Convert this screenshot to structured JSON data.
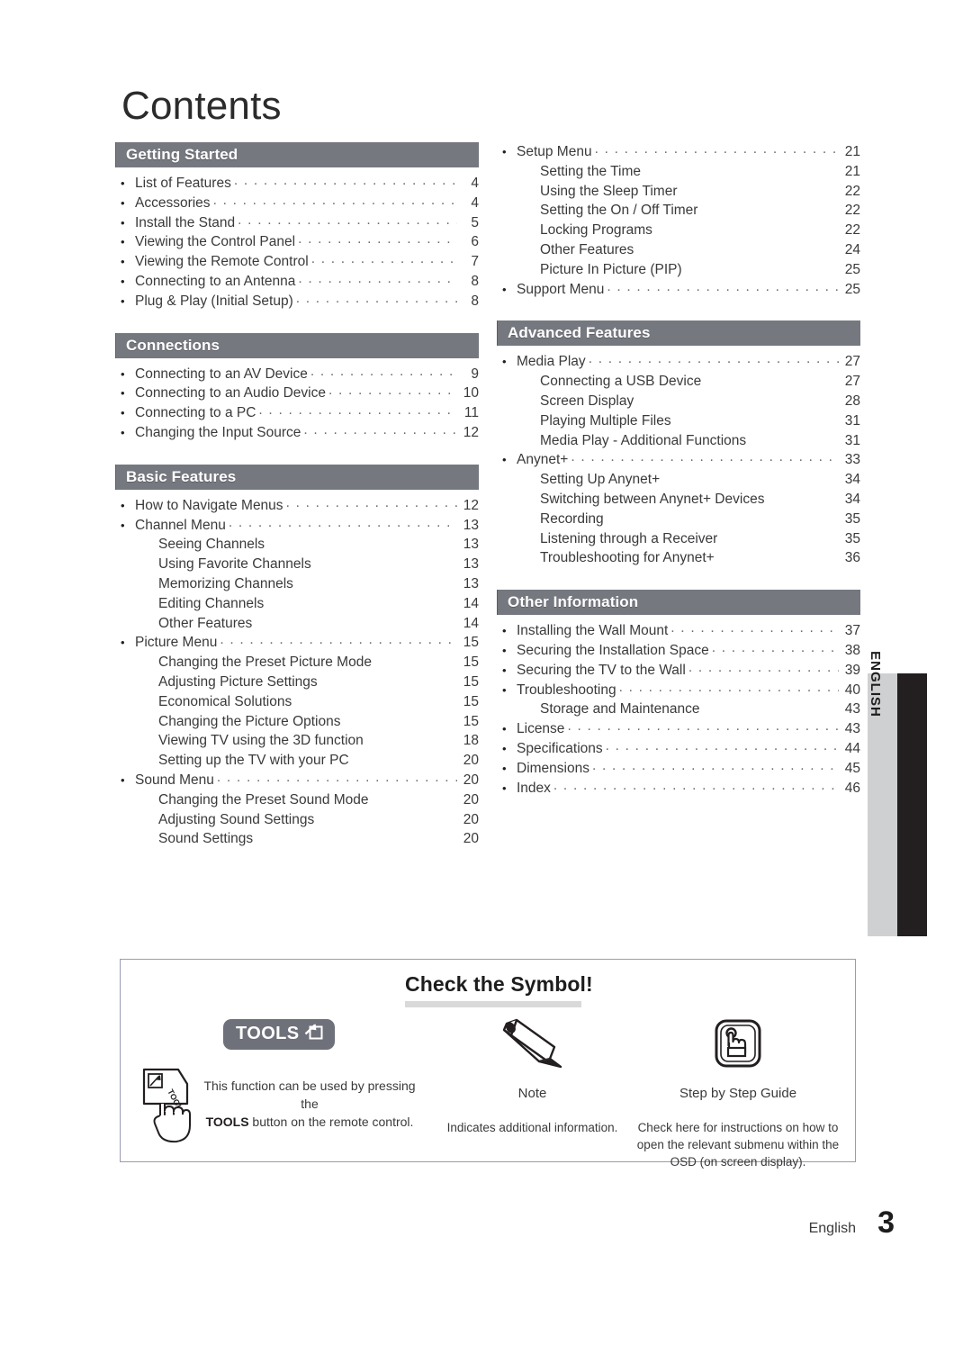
{
  "page": {
    "title": "Contents",
    "side_tab_label": "ENGLISH",
    "footer_language": "English",
    "footer_page_number": "3",
    "accent_bar_color": "#767880",
    "side_tab_color": "#cfd0d2",
    "side_black_color": "#231f20"
  },
  "left_column": [
    {
      "header": "Getting Started",
      "entries": [
        {
          "level": 1,
          "label": "List of Features",
          "page": "4"
        },
        {
          "level": 1,
          "label": "Accessories",
          "page": "4"
        },
        {
          "level": 1,
          "label": "Install the Stand",
          "page": "5"
        },
        {
          "level": 1,
          "label": "Viewing the Control Panel",
          "page": "6"
        },
        {
          "level": 1,
          "label": "Viewing the Remote Control",
          "page": "7"
        },
        {
          "level": 1,
          "label": "Connecting to an Antenna",
          "page": "8"
        },
        {
          "level": 1,
          "label": "Plug & Play (Initial Setup)",
          "page": "8"
        }
      ]
    },
    {
      "header": "Connections",
      "entries": [
        {
          "level": 1,
          "label": "Connecting to an AV Device",
          "page": "9"
        },
        {
          "level": 1,
          "label": "Connecting to an Audio Device",
          "page": "10"
        },
        {
          "level": 1,
          "label": "Connecting to a PC",
          "page": "11"
        },
        {
          "level": 1,
          "label": "Changing the Input Source",
          "page": "12"
        }
      ]
    },
    {
      "header": "Basic Features",
      "entries": [
        {
          "level": 1,
          "label": "How to Navigate Menus",
          "page": "12"
        },
        {
          "level": 1,
          "label": "Channel Menu",
          "page": "13"
        },
        {
          "level": 2,
          "label": "Seeing Channels",
          "page": "13"
        },
        {
          "level": 2,
          "label": "Using Favorite Channels",
          "page": "13"
        },
        {
          "level": 2,
          "label": "Memorizing Channels",
          "page": "13"
        },
        {
          "level": 2,
          "label": "Editing Channels",
          "page": "14"
        },
        {
          "level": 2,
          "label": "Other Features",
          "page": "14"
        },
        {
          "level": 1,
          "label": "Picture Menu",
          "page": "15"
        },
        {
          "level": 2,
          "label": "Changing the Preset Picture Mode",
          "page": "15"
        },
        {
          "level": 2,
          "label": "Adjusting Picture Settings",
          "page": "15"
        },
        {
          "level": 2,
          "label": "Economical Solutions",
          "page": "15"
        },
        {
          "level": 2,
          "label": "Changing the Picture Options",
          "page": "15"
        },
        {
          "level": 2,
          "label": "Viewing TV using the 3D function",
          "page": "18"
        },
        {
          "level": 2,
          "label": "Setting up the TV with your PC",
          "page": "20"
        },
        {
          "level": 1,
          "label": "Sound Menu",
          "page": "20"
        },
        {
          "level": 2,
          "label": "Changing the Preset Sound Mode",
          "page": "20"
        },
        {
          "level": 2,
          "label": "Adjusting Sound Settings",
          "page": "20"
        },
        {
          "level": 2,
          "label": "Sound Settings",
          "page": "20"
        }
      ]
    }
  ],
  "right_column": [
    {
      "header": null,
      "entries": [
        {
          "level": 1,
          "label": "Setup Menu",
          "page": "21"
        },
        {
          "level": 2,
          "label": "Setting the Time",
          "page": "21"
        },
        {
          "level": 2,
          "label": "Using the Sleep Timer",
          "page": "22"
        },
        {
          "level": 2,
          "label": "Setting the On / Off Timer",
          "page": "22"
        },
        {
          "level": 2,
          "label": "Locking Programs",
          "page": "22"
        },
        {
          "level": 2,
          "label": "Other Features",
          "page": "24"
        },
        {
          "level": 2,
          "label": "Picture In Picture (PIP)",
          "page": "25"
        },
        {
          "level": 1,
          "label": "Support Menu",
          "page": "25"
        }
      ]
    },
    {
      "header": "Advanced Features",
      "entries": [
        {
          "level": 1,
          "label": "Media Play",
          "page": "27"
        },
        {
          "level": 2,
          "label": "Connecting a USB Device",
          "page": "27"
        },
        {
          "level": 2,
          "label": "Screen Display",
          "page": "28"
        },
        {
          "level": 2,
          "label": "Playing Multiple Files",
          "page": "31"
        },
        {
          "level": 2,
          "label": "Media Play - Additional Functions",
          "page": "31"
        },
        {
          "level": 1,
          "label": "Anynet+",
          "page": "33"
        },
        {
          "level": 2,
          "label": "Setting Up Anynet+",
          "page": "34"
        },
        {
          "level": 2,
          "label": "Switching between Anynet+ Devices",
          "page": "34"
        },
        {
          "level": 2,
          "label": "Recording",
          "page": "35"
        },
        {
          "level": 2,
          "label": "Listening through a Receiver",
          "page": "35"
        },
        {
          "level": 2,
          "label": "Troubleshooting for Anynet+",
          "page": "36"
        }
      ]
    },
    {
      "header": "Other Information",
      "entries": [
        {
          "level": 1,
          "label": "Installing the Wall Mount",
          "page": "37"
        },
        {
          "level": 1,
          "label": "Securing the Installation Space",
          "page": "38"
        },
        {
          "level": 1,
          "label": "Securing the TV to the Wall",
          "page": "39"
        },
        {
          "level": 1,
          "label": "Troubleshooting",
          "page": "40"
        },
        {
          "level": 2,
          "label": "Storage and Maintenance",
          "page": "43"
        },
        {
          "level": 1,
          "label": "License",
          "page": "43"
        },
        {
          "level": 1,
          "label": "Specifications",
          "page": "44"
        },
        {
          "level": 1,
          "label": "Dimensions",
          "page": "45"
        },
        {
          "level": 1,
          "label": "Index",
          "page": "46"
        }
      ]
    }
  ],
  "symbol_box": {
    "title": "Check the Symbol!",
    "tools_badge_label": "TOOLS",
    "tools_description_line1": "This function can be used by pressing the",
    "tools_description_line2_bold": "TOOLS",
    "tools_description_line2_rest": " button on the remote control.",
    "note_caption": "Note",
    "note_description": "Indicates additional information.",
    "guide_caption": "Step by Step Guide",
    "guide_description": "Check here for instructions on how to open the relevant submenu within the OSD (on screen display)."
  }
}
